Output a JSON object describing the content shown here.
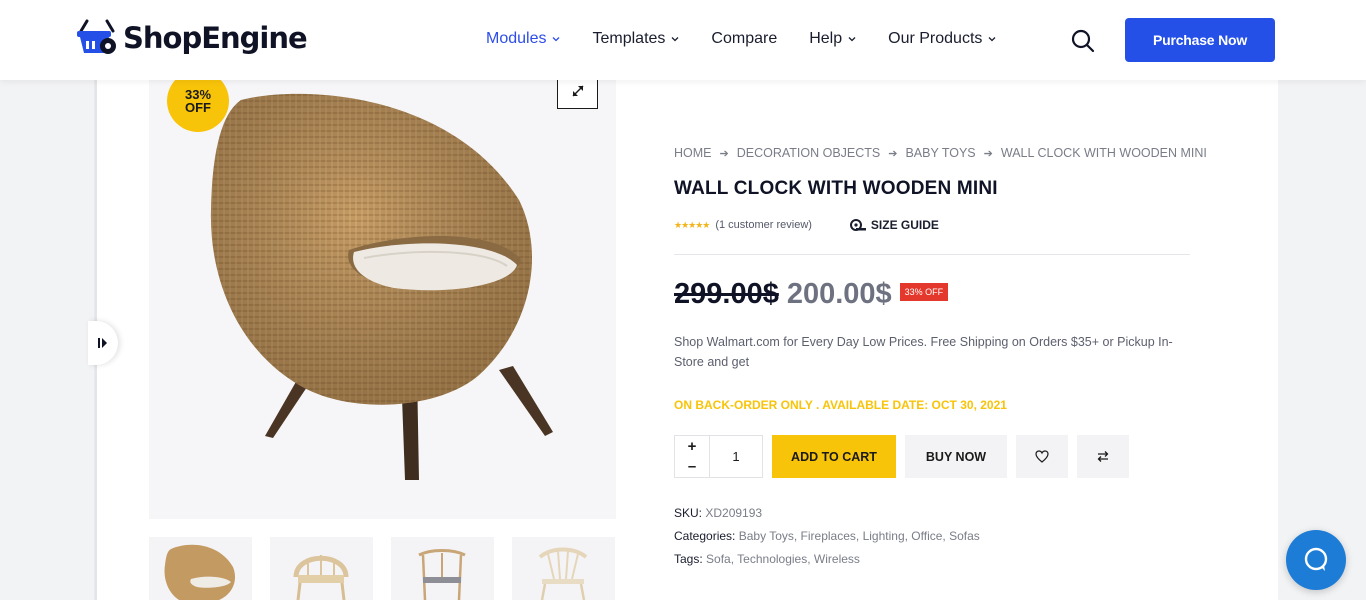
{
  "header": {
    "logo_text": "ShopEngine",
    "nav": [
      {
        "label": "Modules",
        "active": true,
        "has_dropdown": true
      },
      {
        "label": "Templates",
        "active": false,
        "has_dropdown": true
      },
      {
        "label": "Compare",
        "active": false,
        "has_dropdown": false
      },
      {
        "label": "Help",
        "active": false,
        "has_dropdown": true
      },
      {
        "label": "Our Products",
        "active": false,
        "has_dropdown": true
      }
    ],
    "purchase_label": "Purchase Now"
  },
  "gallery": {
    "badge_percent": "33%",
    "badge_off": "OFF",
    "main_image_alt": "woven rattan chair"
  },
  "product": {
    "breadcrumb": [
      "HOME",
      "DECORATION OBJECTS",
      "BABY TOYS",
      "WALL CLOCK WITH WOODEN MINI"
    ],
    "title": "WALL CLOCK WITH WOODEN MINI",
    "rating_stars": 5,
    "review_text": "(1 customer review)",
    "size_guide_label": "SIZE GUIDE",
    "old_price": "299.00$",
    "new_price": "200.00$",
    "discount_tag": "33% OFF",
    "description": "Shop Walmart.com for Every Day Low Prices. Free Shipping on Orders $35+ or Pickup In-Store and get",
    "availability": "ON BACK-ORDER ONLY . AVAILABLE DATE: OCT 30, 2021",
    "quantity": "1",
    "qty_plus": "+",
    "qty_minus": "–",
    "add_to_cart_label": "ADD TO CART",
    "buy_now_label": "BUY NOW",
    "sku_label": "SKU:",
    "sku_value": "XD209193",
    "categories_label": "Categories:",
    "categories": [
      "Baby Toys",
      "Fireplaces",
      "Lighting",
      "Office",
      "Sofas"
    ],
    "tags_label": "Tags:",
    "tags": [
      "Sofa",
      "Technologies",
      "Wireless"
    ]
  },
  "colors": {
    "accent_blue": "#2450e8",
    "badge_yellow": "#f8c40a",
    "sale_red": "#e3382b",
    "chat_blue": "#1c7cd6"
  }
}
